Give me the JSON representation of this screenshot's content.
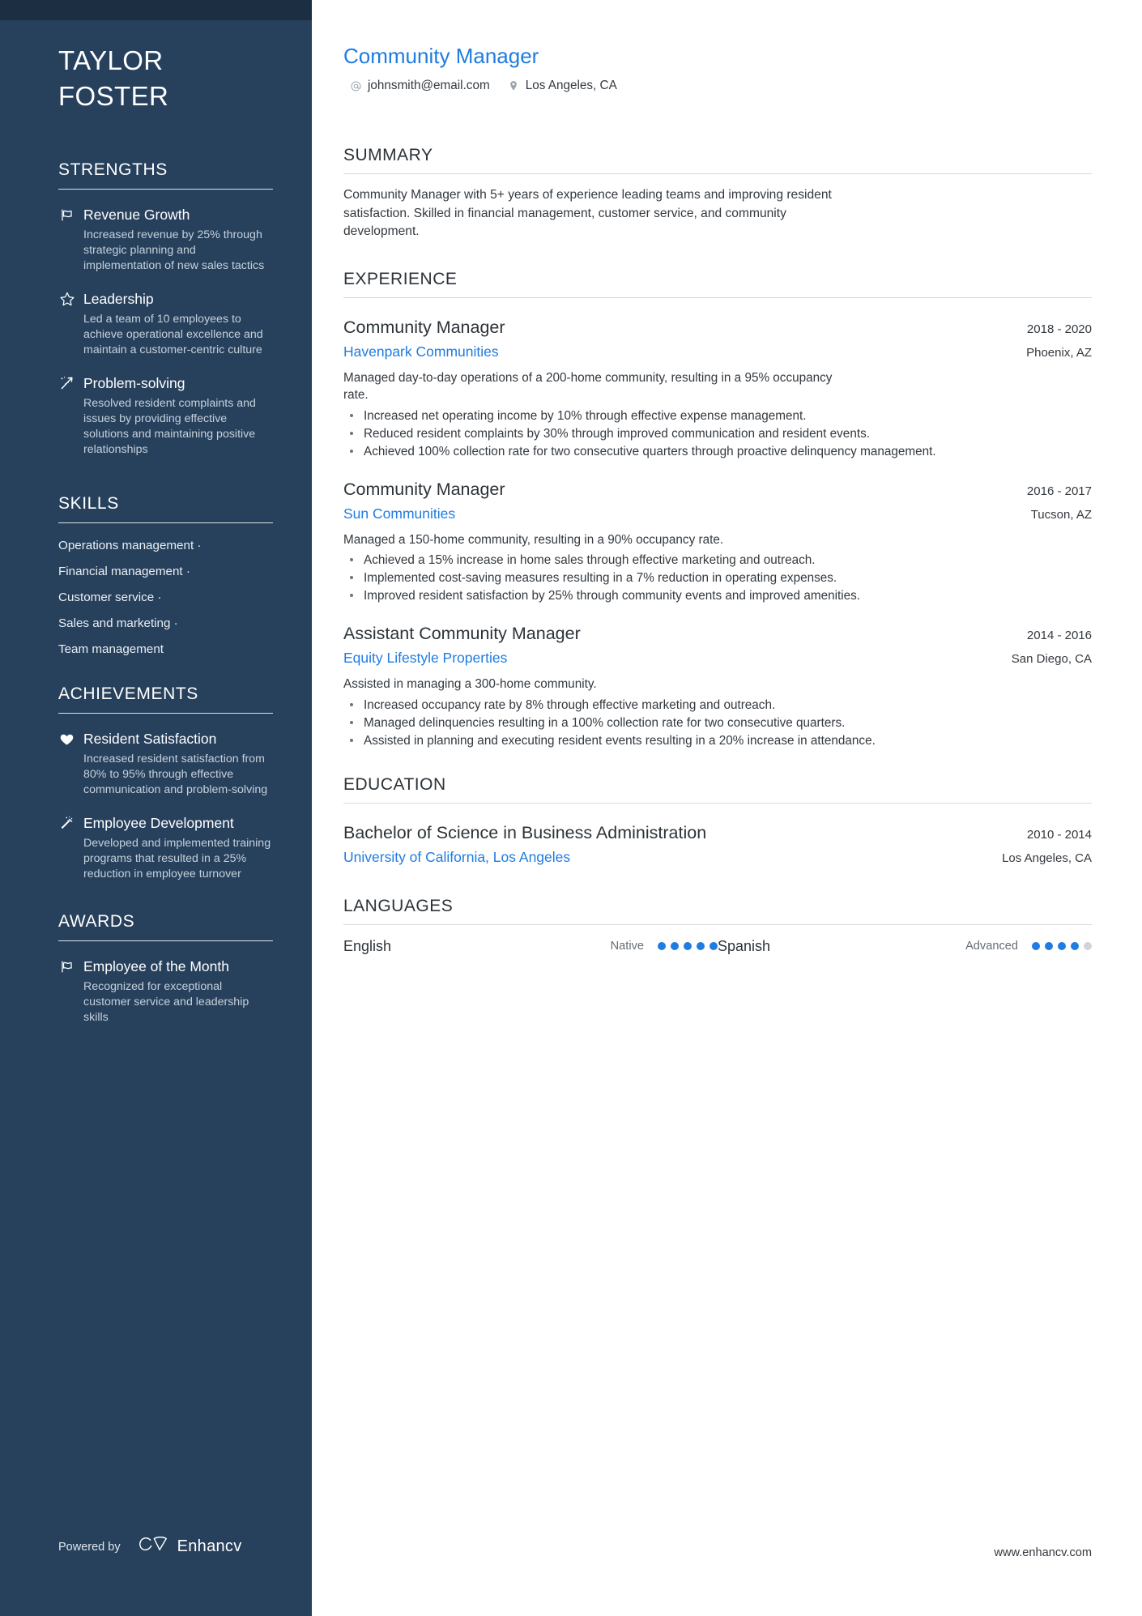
{
  "colors": {
    "sidebar_bg": "#27415d",
    "sidebar_top": "#1b2e42",
    "accent_blue": "#1f7ce0",
    "heading": "#2c3338"
  },
  "sidebar": {
    "name_first": "TAYLOR",
    "name_last": "FOSTER",
    "strengths": {
      "heading": "STRENGTHS",
      "items": [
        {
          "icon": "flag-icon",
          "title": "Revenue Growth",
          "desc": "Increased revenue by 25% through strategic planning and implementation of new sales tactics"
        },
        {
          "icon": "star-icon",
          "title": "Leadership",
          "desc": "Led a team of 10 employees to achieve operational excellence and maintain a customer-centric culture"
        },
        {
          "icon": "sparkle-arrow-icon",
          "title": "Problem-solving",
          "desc": "Resolved resident complaints and issues by providing effective solutions and maintaining positive relationships"
        }
      ]
    },
    "skills": {
      "heading": "SKILLS",
      "items": [
        "Operations management ·",
        "Financial management ·",
        "Customer service ·",
        "Sales and marketing ·",
        "Team management"
      ]
    },
    "achievements": {
      "heading": "ACHIEVEMENTS",
      "items": [
        {
          "icon": "heart-icon",
          "title": "Resident Satisfaction",
          "desc": "Increased resident satisfaction from 80% to 95% through effective communication and problem-solving"
        },
        {
          "icon": "magic-wand-icon",
          "title": "Employee Development",
          "desc": "Developed and implemented training programs that resulted in a 25% reduction in employee turnover"
        }
      ]
    },
    "awards": {
      "heading": "AWARDS",
      "items": [
        {
          "icon": "flag-icon",
          "title": "Employee of the Month",
          "desc": "Recognized for exceptional customer service and leadership skills"
        }
      ]
    },
    "footer": {
      "powered_label": "Powered by",
      "brand": "Enhancv",
      "brand_icon": "enhancv-logo-icon"
    }
  },
  "main": {
    "job_title": "Community Manager",
    "contacts": [
      {
        "icon": "at-icon",
        "text": "johnsmith@email.com"
      },
      {
        "icon": "location-pin-icon",
        "text": "Los Angeles, CA"
      }
    ],
    "summary": {
      "heading": "SUMMARY",
      "text": "Community Manager with 5+ years of experience leading teams and improving resident satisfaction. Skilled in financial management, customer service, and community development."
    },
    "experience": {
      "heading": "EXPERIENCE",
      "entries": [
        {
          "title": "Community Manager",
          "date": "2018 - 2020",
          "org": "Havenpark Communities",
          "location": "Phoenix, AZ",
          "desc": "Managed day-to-day operations of a 200-home community, resulting in a 95% occupancy rate.",
          "bullets": [
            "Increased net operating income by 10% through effective expense management.",
            "Reduced resident complaints by 30% through improved communication and resident events.",
            "Achieved 100% collection rate for two consecutive quarters through proactive delinquency management."
          ]
        },
        {
          "title": "Community Manager",
          "date": "2016 - 2017",
          "org": "Sun Communities",
          "location": "Tucson, AZ",
          "desc": "Managed a 150-home community, resulting in a 90% occupancy rate.",
          "bullets": [
            "Achieved a 15% increase in home sales through effective marketing and outreach.",
            "Implemented cost-saving measures resulting in a 7% reduction in operating expenses.",
            "Improved resident satisfaction by 25% through community events and improved amenities."
          ]
        },
        {
          "title": "Assistant Community Manager",
          "date": "2014 - 2016",
          "org": "Equity Lifestyle Properties",
          "location": "San Diego, CA",
          "desc": "Assisted in managing a 300-home community.",
          "bullets": [
            "Increased occupancy rate by 8% through effective marketing and outreach.",
            "Managed delinquencies resulting in a 100% collection rate for two consecutive quarters.",
            "Assisted in planning and executing resident events resulting in a 20% increase in attendance."
          ]
        }
      ]
    },
    "education": {
      "heading": "EDUCATION",
      "entries": [
        {
          "title": "Bachelor of Science in Business Administration",
          "date": "2010 - 2014",
          "org": "University of California, Los Angeles",
          "location": "Los Angeles, CA"
        }
      ]
    },
    "languages": {
      "heading": "LANGUAGES",
      "items": [
        {
          "name": "English",
          "level": "Native",
          "filled": 5,
          "total": 5
        },
        {
          "name": "Spanish",
          "level": "Advanced",
          "filled": 4,
          "total": 5
        }
      ]
    },
    "site_url": "www.enhancv.com"
  }
}
